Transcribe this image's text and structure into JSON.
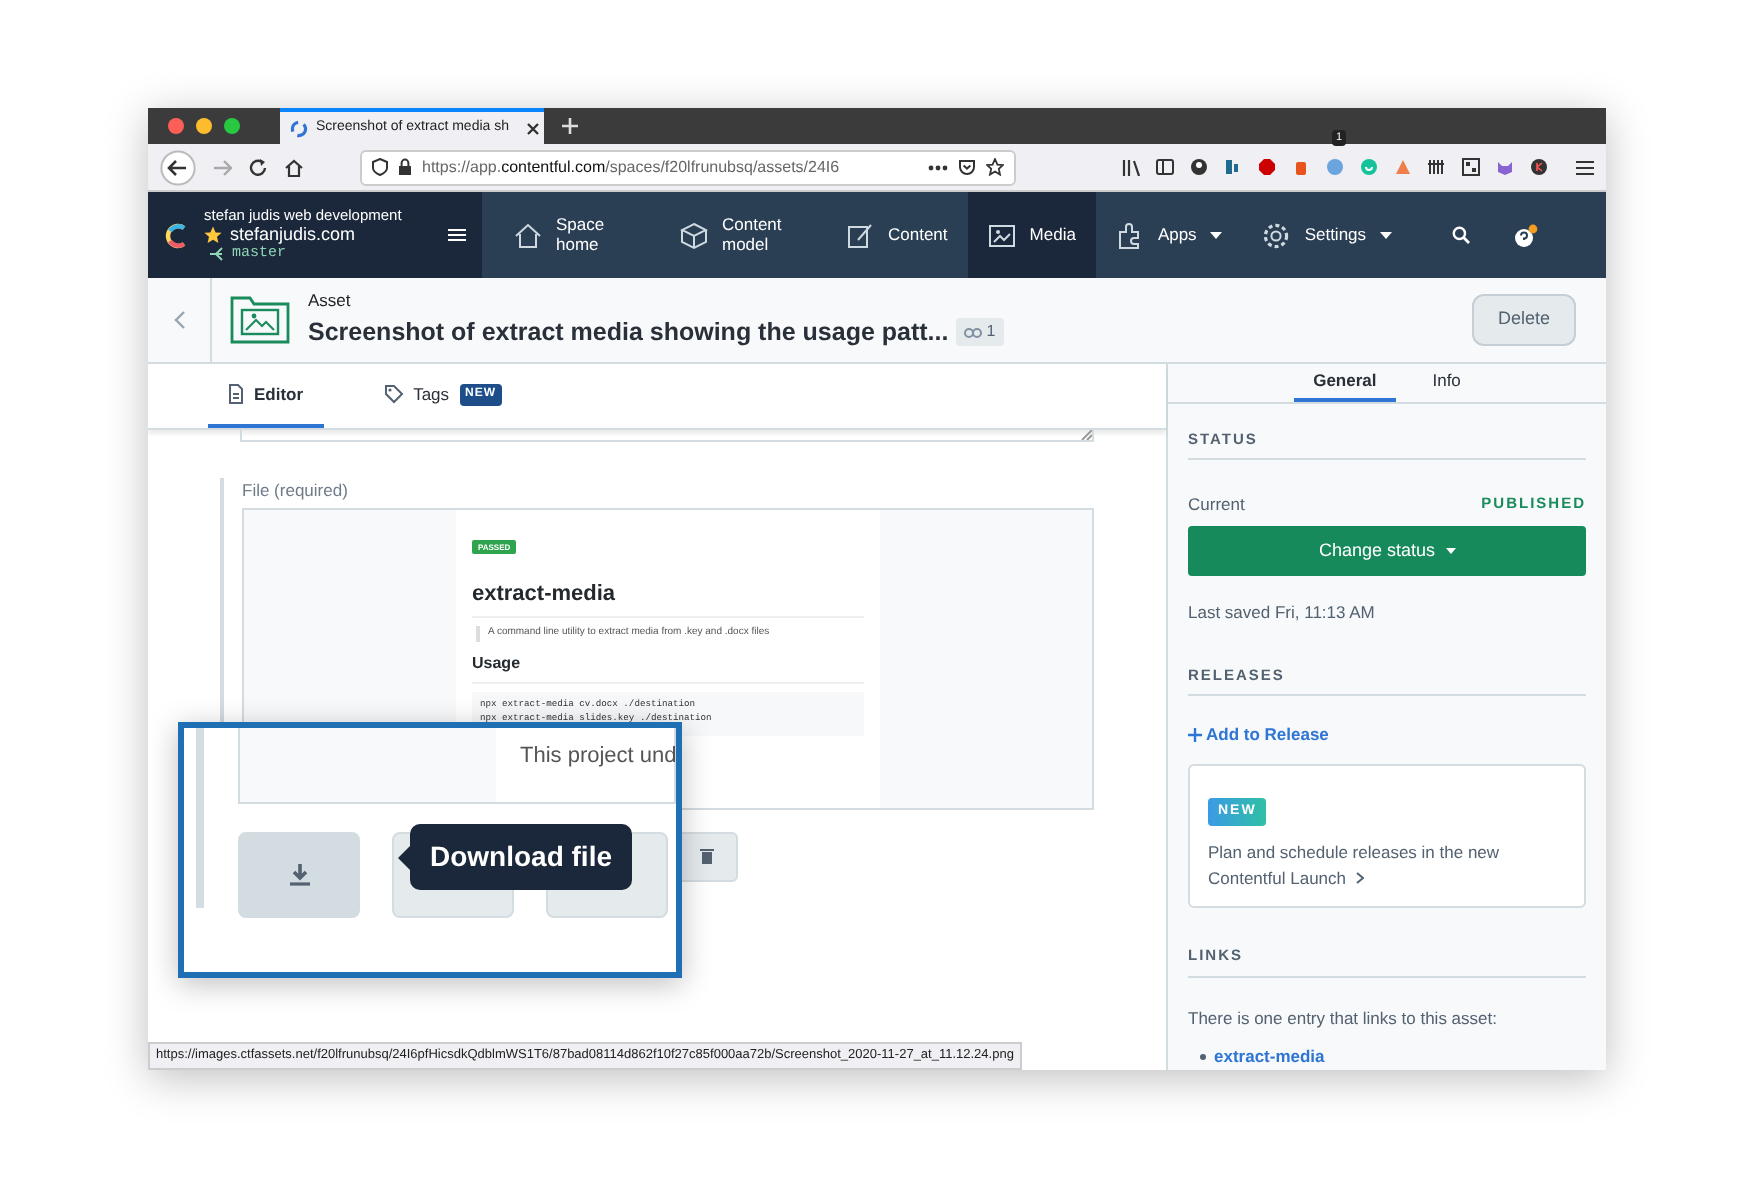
{
  "browser": {
    "tab_title": "Screenshot of extract media sh",
    "url_prefix": "https://app.",
    "url_host": "contentful.com",
    "url_path": "/spaces/f20lfrunubsq/assets/24I6",
    "extension_badge": "1",
    "status_url": "https://images.ctfassets.net/f20lfrunubsq/24I6pfHicsdkQdblmWS1T6/87bad08114d862f10f27c85f000aa72b/Screenshot_2020-11-27_at_11.12.24.png"
  },
  "navbar": {
    "org": "stefan judis web development",
    "space": "stefanjudis.com",
    "environment": "master",
    "items": [
      {
        "label": "Space home",
        "selected": false,
        "has_menu": false
      },
      {
        "label": "Content model",
        "selected": false,
        "has_menu": false
      },
      {
        "label": "Content",
        "selected": false,
        "has_menu": false
      },
      {
        "label": "Media",
        "selected": true,
        "has_menu": false
      },
      {
        "label": "Apps",
        "selected": false,
        "has_menu": true
      },
      {
        "label": "Settings",
        "selected": false,
        "has_menu": true
      }
    ]
  },
  "header": {
    "type": "Asset",
    "title": "Screenshot of extract media showing the usage patt...",
    "link_count": "1",
    "delete": "Delete"
  },
  "editor_tabs": [
    {
      "label": "Editor",
      "selected": true
    },
    {
      "label": "Tags",
      "badge": "NEW",
      "selected": false
    }
  ],
  "file_field": {
    "label": "File (required)",
    "preview": {
      "badge": "PASSED",
      "heading": "extract-media",
      "description": "A command line utility to extract media from .key and .docx files",
      "subheading": "Usage",
      "code": [
        "npx extract-media cv.docx ./destination",
        "npx extract-media slides.key ./destination"
      ]
    }
  },
  "sidebar": {
    "tabs": [
      {
        "label": "General",
        "selected": true
      },
      {
        "label": "Info",
        "selected": false
      }
    ],
    "status": {
      "heading": "STATUS",
      "current_label": "Current",
      "current_value": "PUBLISHED",
      "button": "Change status",
      "last_saved": "Last saved Fri, 11:13 AM"
    },
    "releases": {
      "heading": "RELEASES",
      "add": "Add to Release",
      "card_badge": "NEW",
      "card_text": "Plan and schedule releases in the new Contentful",
      "card_link": "Launch"
    },
    "links": {
      "heading": "LINKS",
      "text": "There is one entry that links to this asset:",
      "entries": [
        "extract-media"
      ]
    }
  },
  "callout": {
    "cut_text": "This project und",
    "tooltip": "Download file"
  }
}
